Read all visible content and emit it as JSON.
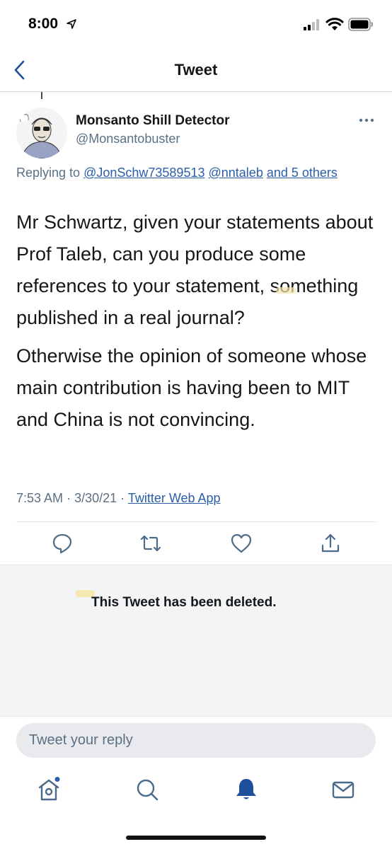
{
  "status_bar": {
    "time": "8:00"
  },
  "nav": {
    "title": "Tweet"
  },
  "tweet": {
    "author_name": "Monsanto Shill Detector",
    "author_handle": "@Monsantobuster",
    "replying_prefix": "Replying to",
    "replying_links": [
      "@JonSchw73589513",
      "@nntaleb",
      "and 5 others"
    ],
    "paragraphs": [
      "Mr Schwartz, given your statements about Prof Taleb, can you produce some references to your statement, something published in a real journal?",
      "Otherwise the opinion of someone whose main contribution is having been to MIT and China is not convincing."
    ],
    "time": "7:53 AM",
    "date": "3/30/21",
    "separator": "·",
    "source": "Twitter Web App"
  },
  "deleted_notice": "This Tweet has been deleted.",
  "reply": {
    "placeholder": "Tweet your reply"
  },
  "icons": {
    "actions": [
      "reply-icon",
      "retweet-icon",
      "like-icon",
      "share-icon"
    ],
    "tabs": [
      "home-icon",
      "search-icon",
      "notifications-icon",
      "messages-icon"
    ]
  },
  "colors": {
    "link": "#2b5ea8",
    "accent": "#1d4f9c",
    "secondary_text": "#5b7083",
    "notification_dot": "#2b5ea8"
  }
}
